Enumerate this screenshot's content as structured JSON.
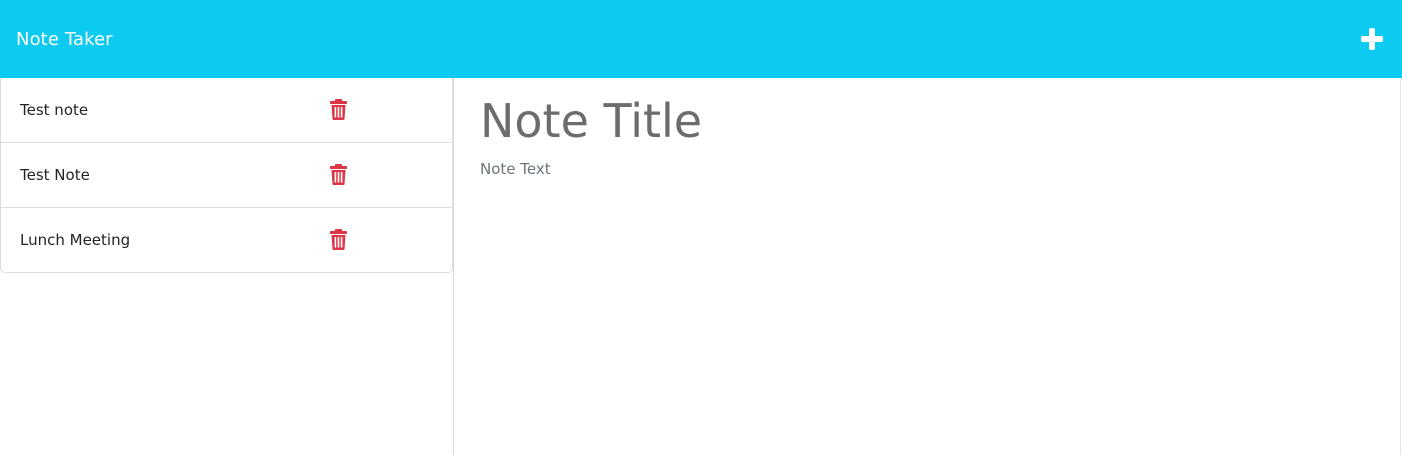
{
  "navbar": {
    "brand": "Note Taker",
    "add_icon": "plus-icon",
    "background": "#0dcaf0"
  },
  "notes": [
    {
      "title": "Test note",
      "delete_icon": "trash-icon"
    },
    {
      "title": "Test Note",
      "delete_icon": "trash-icon"
    },
    {
      "title": "Lunch Meeting",
      "delete_icon": "trash-icon"
    }
  ],
  "editor": {
    "title_placeholder": "Note Title",
    "text_placeholder": "Note Text"
  },
  "colors": {
    "delete": "#dc3545"
  }
}
